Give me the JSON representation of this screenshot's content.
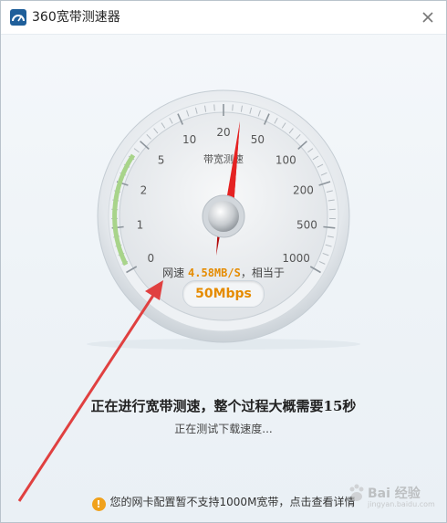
{
  "window": {
    "title": "360宽带测速器",
    "close_icon": "close-icon"
  },
  "gauge": {
    "title": "带宽测速",
    "ticks": [
      "0",
      "1",
      "2",
      "5",
      "10",
      "20",
      "50",
      "100",
      "200",
      "500",
      "1000"
    ],
    "needle_value": "20",
    "colors": {
      "needle": "#cc1010",
      "arc_green": "#a8d48a",
      "speed_orange": "#e58b00"
    }
  },
  "speed": {
    "prefix": "网速",
    "value": "4.58MB/S",
    "suffix": "，相当于",
    "mbps": "50Mbps"
  },
  "status": {
    "main": "正在进行宽带测速，整个过程大概需要15秒",
    "sub": "正在测试下载速度..."
  },
  "footer": {
    "icon": "warning-icon",
    "text": "您的网卡配置暂不支持1000M宽带，",
    "link": "点击查看详情"
  },
  "watermark": {
    "text": "Bai 经验",
    "sub": "jingyan.baidu.com"
  }
}
